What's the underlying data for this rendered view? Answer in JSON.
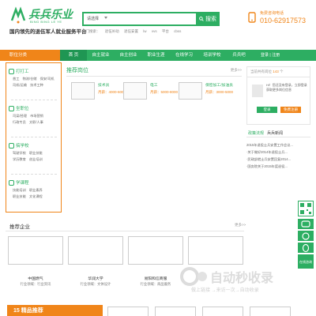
{
  "header": {
    "logo_text": "兵兵乐业",
    "logo_sub": "BING BING LE YE",
    "slogan": "国内领先的退伍军人就业服务平台",
    "search": {
      "category": "请选择",
      "placeholder": "",
      "button_label": "搜索"
    },
    "hot_label": "热门搜索：",
    "hot_terms": [
      "退伍补助",
      "退伍安置",
      "lw",
      "vvs",
      "平台",
      "cbss"
    ],
    "phone_label": "免费咨询电话",
    "phone": "010-62917573"
  },
  "nav": {
    "category_label": "职位分类",
    "items": [
      "首 页",
      "自主就业",
      "自主创业",
      "职业生涯",
      "在线学习",
      "培训学校",
      "兵兵吧"
    ],
    "active_index": 0,
    "login": "登录 | 注册"
  },
  "sidebar": {
    "groups": [
      {
        "title": "打打工",
        "links": [
          "普工",
          "物流/仓储",
          "保安/司机",
          "司机/运输",
          "技术工种"
        ]
      },
      {
        "title": "坐职位",
        "links": [
          "司梁/经理",
          "市场营销",
          "行政专员",
          "文职/人事"
        ]
      },
      {
        "title": "搞学校",
        "links": [
          "驾驶学校",
          "职业技能",
          "学历教育",
          "创业培训"
        ]
      },
      {
        "title": "学课程",
        "links": [
          "技能培训",
          "职业素养",
          "职业技能",
          "文化课程"
        ]
      }
    ]
  },
  "jobs": {
    "title": "推荐岗位",
    "more": "更多>>",
    "items": [
      {
        "name": "技术员",
        "salary": "月薪：4000-6000"
      },
      {
        "name": "电工",
        "salary": "月薪：5000-8000"
      },
      {
        "name": "保密加工/加油员",
        "salary": "月薪：3000-5000"
      }
    ]
  },
  "user_box": {
    "head_prefix": "当前共有岗位",
    "count": "143",
    "head_suffix": "个",
    "text": "Hi！您还没有登录，立即登录获取更多岗位信息",
    "login_label": "登录",
    "register_label": "免费注册"
  },
  "news": {
    "tabs": [
      "政策法规",
      "兵兵新闻"
    ],
    "active_tab": 0,
    "items": [
      "2015年退役士兵安置工作会议...",
      "·关于做好2014年退役士兵...",
      "·民政部就士兵安置回复2014...",
      "·国务院关于2015年度退役..."
    ]
  },
  "enterprises": {
    "title": "推荐企业",
    "more": "更多>>",
    "items": [
      {
        "name": "中国燃气",
        "info": "行业领域：行业资讯"
      },
      {
        "name": "华润大学",
        "info": "行业领域：文体设计"
      },
      {
        "name": "易阳和信商服",
        "info": "行业领域：商品服务"
      },
      {
        "name": "",
        "info": ""
      }
    ]
  },
  "bottom": {
    "title": "15 精品推荐"
  },
  "float_bar": {
    "top_label": "在线咨询"
  },
  "watermark": {
    "main": "自动秒收录",
    "sub": "做上链接  →来访一次→自动收录"
  },
  "colors": {
    "brand_green": "#2dae62",
    "accent_orange": "#f08519"
  }
}
